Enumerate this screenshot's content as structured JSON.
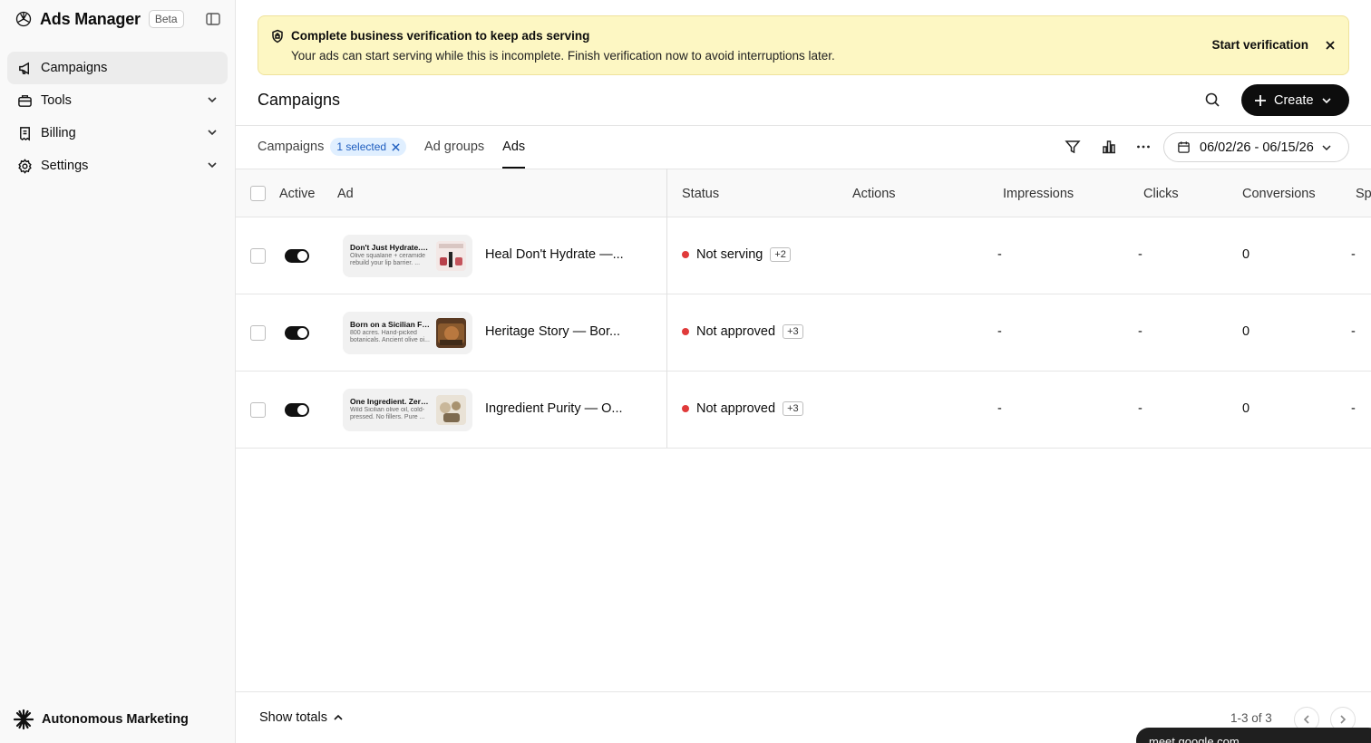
{
  "app": {
    "name": "Ads Manager",
    "badge": "Beta"
  },
  "sidebar": {
    "items": [
      {
        "label": "Campaigns",
        "icon": "megaphone-icon",
        "active": true
      },
      {
        "label": "Tools",
        "icon": "toolbox-icon"
      },
      {
        "label": "Billing",
        "icon": "receipt-icon"
      },
      {
        "label": "Settings",
        "icon": "gear-icon"
      }
    ],
    "workspace": "Autonomous Marketing"
  },
  "banner": {
    "title": "Complete business verification to keep ads serving",
    "text": "Your ads can start serving while this is incomplete. Finish verification now to avoid interruptions later.",
    "action": "Start verification",
    "color": "#fdf7c3"
  },
  "header": {
    "title": "Campaigns",
    "create_label": "Create"
  },
  "tabs": {
    "campaigns": "Campaigns",
    "selected_chip": "1 selected",
    "ad_groups": "Ad groups",
    "ads": "Ads"
  },
  "date_range": "06/02/26 - 06/15/26",
  "table": {
    "columns": {
      "active": "Active",
      "ad": "Ad",
      "status": "Status",
      "actions": "Actions",
      "impressions": "Impressions",
      "clicks": "Clicks",
      "conversions": "Conversions",
      "spend": "Sp"
    },
    "rows": [
      {
        "preview_title": "Don't Just Hydrate. Heal.",
        "preview_desc": "Olive squalane + ceramide rebuild your lip barrier. ...",
        "name": "Heal Don't Hydrate —...",
        "status": "Not serving",
        "status_more": "+2",
        "impressions": "-",
        "clicks": "-",
        "conversions": "0",
        "spend": "-"
      },
      {
        "preview_title": "Born on a Sicilian Farm",
        "preview_desc": "800 acres. Hand-picked botanicals. Ancient olive oi...",
        "name": "Heritage Story — Bor...",
        "status": "Not approved",
        "status_more": "+3",
        "impressions": "-",
        "clicks": "-",
        "conversions": "0",
        "spend": "-"
      },
      {
        "preview_title": "One Ingredient. Zero ...",
        "preview_desc": "Wild Sicilian olive oil, cold-pressed. No fillers. Pure ...",
        "name": "Ingredient Purity — O...",
        "status": "Not approved",
        "status_more": "+3",
        "impressions": "-",
        "clicks": "-",
        "conversions": "0",
        "spend": "-"
      }
    ]
  },
  "footer": {
    "show_totals": "Show totals",
    "page_info": "1-3 of 3"
  },
  "overlay": {
    "text": "meet.google.com"
  },
  "colors": {
    "status_red": "#e03a3a",
    "chip_bg": "#e0efff",
    "chip_text": "#1e5dbf"
  }
}
